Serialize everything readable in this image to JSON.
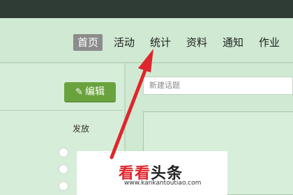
{
  "nav": {
    "items": [
      {
        "label": "首页",
        "active": true
      },
      {
        "label": "活动",
        "active": false
      },
      {
        "label": "统计",
        "active": false
      },
      {
        "label": "资料",
        "active": false
      },
      {
        "label": "通知",
        "active": false
      },
      {
        "label": "作业",
        "active": false
      }
    ]
  },
  "edit_button": {
    "label": "编辑",
    "icon": "pencil-icon"
  },
  "left_panel": {
    "section_label": "发放"
  },
  "topic_input": {
    "placeholder": "新建话题",
    "value": ""
  },
  "watermark": {
    "text_red": "看看",
    "text_dark": "头条",
    "url": "www.kankantoutiao.com"
  },
  "colors": {
    "topbar": "#2f3b35",
    "background": "#cfe9d2",
    "edit_button": "#6aa33e",
    "arrow": "#e0262d"
  }
}
